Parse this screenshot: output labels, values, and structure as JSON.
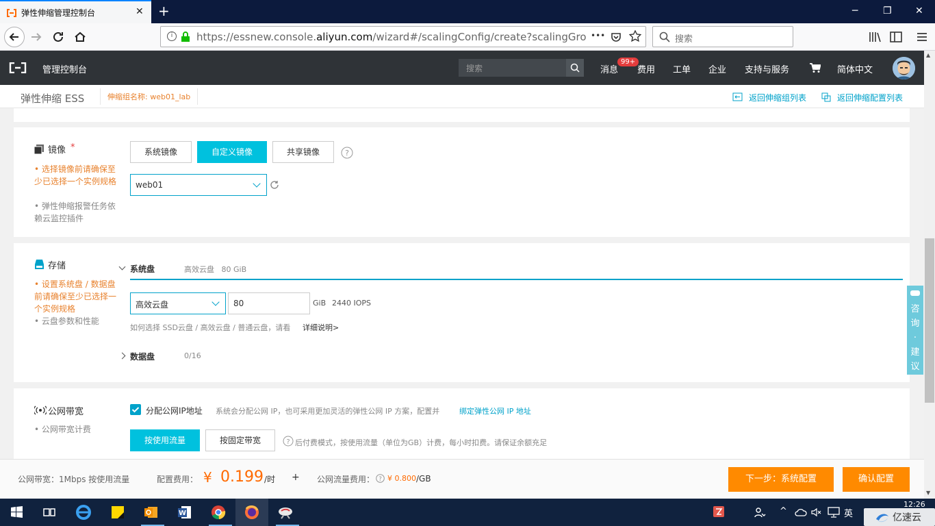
{
  "browser": {
    "tab_title": "弹性伸缩管理控制台",
    "url_prefix": "https://essnew.console.",
    "url_domain": "aliyun.com",
    "url_rest": "/wizard#/scalingConfig/create?scalingGroupId=",
    "search_placeholder": "搜索",
    "more": "•••"
  },
  "console": {
    "home": "管理控制台",
    "search_placeholder": "搜索",
    "nav": [
      "消息",
      "费用",
      "工单",
      "企业",
      "支持与服务",
      "简体中文"
    ],
    "badge": "99+"
  },
  "subheader": {
    "title": "弹性伸缩 ESS",
    "group_label": "伸缩组名称: web01_lab",
    "back_group_list": "返回伸缩组列表",
    "back_config_list": "返回伸缩配置列表"
  },
  "image_section": {
    "title": "镜像",
    "required": "*",
    "tip1": "选择镜像前请确保至少已选择一个实例规格",
    "tip2": "弹性伸缩报警任务依赖云监控插件",
    "tabs": [
      "系统镜像",
      "自定义镜像",
      "共享镜像"
    ],
    "active_tab": 1,
    "selected_image": "web01"
  },
  "storage_section": {
    "title": "存储",
    "tip1": "设置系统盘 / 数据盘前请确保至少已选择一个实例规格",
    "tip2": "云盘参数和性能",
    "system_disk_label": "系统盘",
    "system_disk_summary": "高效云盘   80 GiB",
    "disk_type": "高效云盘",
    "disk_size": "80",
    "unit": "GiB",
    "iops": "2440 IOPS",
    "help_text": "如何选择 SSD云盘 / 高效云盘 / 普通云盘，请看",
    "help_link": "详细说明>",
    "data_disk_label": "数据盘",
    "data_disk_count": "0/16"
  },
  "bandwidth_section": {
    "title": "公网带宽",
    "tip": "公网带宽计费",
    "assign_ip_label": "分配公网IP地址",
    "assign_ip_checked": true,
    "assign_desc": "系统会分配公网 IP，也可采用更加灵活的弹性公网 IP 方案，配置并",
    "assign_link": "绑定弹性公网 IP 地址",
    "modes": [
      "按使用流量",
      "按固定带宽"
    ],
    "active_mode": 0,
    "mode_desc": "后付费模式，按使用流量（单位为GB）计费，每小时扣费。请保证余额充足"
  },
  "footer": {
    "bandwidth_summary": "公网带宽：1Mbps 按使用流量",
    "config_fee_label": "配置费用：",
    "currency": "¥",
    "config_fee": "0.199",
    "per_hour": "/时",
    "plus": "+",
    "traffic_fee_label": "公网流量费用：",
    "traffic_fee": "¥ 0.800",
    "per_gb": "/GB",
    "next_button": "下一步：系统配置",
    "confirm_button": "确认配置"
  },
  "consult": "咨询·建议",
  "taskbar": {
    "time": "12:26",
    "ime": "英",
    "watermark": "亿速云"
  },
  "colors": {
    "accent": "#00c1de",
    "link": "#00a2ca",
    "orange": "#ff8a00",
    "header_bg": "#2f3337"
  }
}
